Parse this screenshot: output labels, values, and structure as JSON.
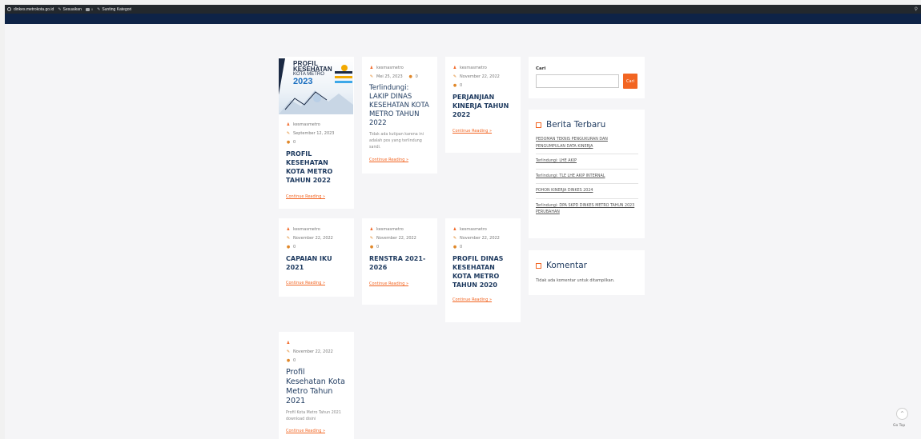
{
  "adminbar": {
    "site": "dinkes.metrokota.go.id",
    "customize": "Sesuaikan",
    "comments_count": "0",
    "edit_category": "Sunting Kategori"
  },
  "posts": [
    {
      "author": "kesmasmetro",
      "date": "September 12, 2023",
      "comments": "0",
      "title": "PROFIL KESEHATAN KOTA METRO TAHUN 2022",
      "excerpt": "",
      "more": "Continue Reading »",
      "thumb": {
        "l1": "PROFIL",
        "l2": "KESEHATAN",
        "l3": "KOTA METRO",
        "l4": "2023"
      }
    },
    {
      "author": "kesmasmetro",
      "date": "Mei 25, 2023",
      "comments": "0",
      "title": "Terlindungi: LAKIP DINAS KESEHATAN KOTA METRO TAHUN 2022",
      "excerpt": "Tidak ada kutipan karena ini adalah pos yang terlindung sandi.",
      "more": "Continue Reading »"
    },
    {
      "author": "kesmasmetro",
      "date": "November 22, 2022",
      "comments": "0",
      "title": "PERJANJIAN KINERJA TAHUN 2022",
      "excerpt": "",
      "more": "Continue Reading »"
    },
    {
      "author": "kesmasmetro",
      "date": "November 22, 2022",
      "comments": "0",
      "title": "CAPAIAN IKU 2021",
      "excerpt": "",
      "more": "Continue Reading »"
    },
    {
      "author": "kesmasmetro",
      "date": "November 22, 2022",
      "comments": "0",
      "title": "RENSTRA 2021-2026",
      "excerpt": "",
      "more": "Continue Reading »"
    },
    {
      "author": "kesmasmetro",
      "date": "November 22, 2022",
      "comments": "0",
      "title": "PROFIL DINAS KESEHATAN KOTA METRO TAHUN 2020",
      "excerpt": "",
      "more": "Continue Reading »"
    },
    {
      "author": "",
      "date": "November 22, 2022",
      "comments": "0",
      "title": "Profil Kesehatan Kota Metro Tahun 2021",
      "excerpt": "Profil Kota Metro Tahun 2021 download disini",
      "more": "Continue Reading »"
    }
  ],
  "sidebar": {
    "search": {
      "label": "Cari",
      "button": "Cari",
      "placeholder": ""
    },
    "recent": {
      "heading": "Berita Terbaru",
      "items": [
        "PEDOMAN TEKNIS PENGUKURAN DAN PENGUMPULAN DATA KINERJA",
        "Terlindungi: LHE AKIP",
        "Terlindungi: TLE LHE AKIP INTERNAL",
        "POHON KINERJA DINKES 2024",
        "Terlindungi: DPA SKPD DINKES METRO TAHUN 2023 PERUBAHAN"
      ]
    },
    "comments": {
      "heading": "Komentar",
      "empty": "Tidak ada komentar untuk ditampilkan."
    }
  },
  "gotop": {
    "icon": "chevron-up-icon",
    "label": "Go Top"
  },
  "colors": {
    "accent": "#f26522",
    "heading": "#1e3a5f",
    "nav": "#0e2347",
    "adminbar": "#23282d"
  }
}
